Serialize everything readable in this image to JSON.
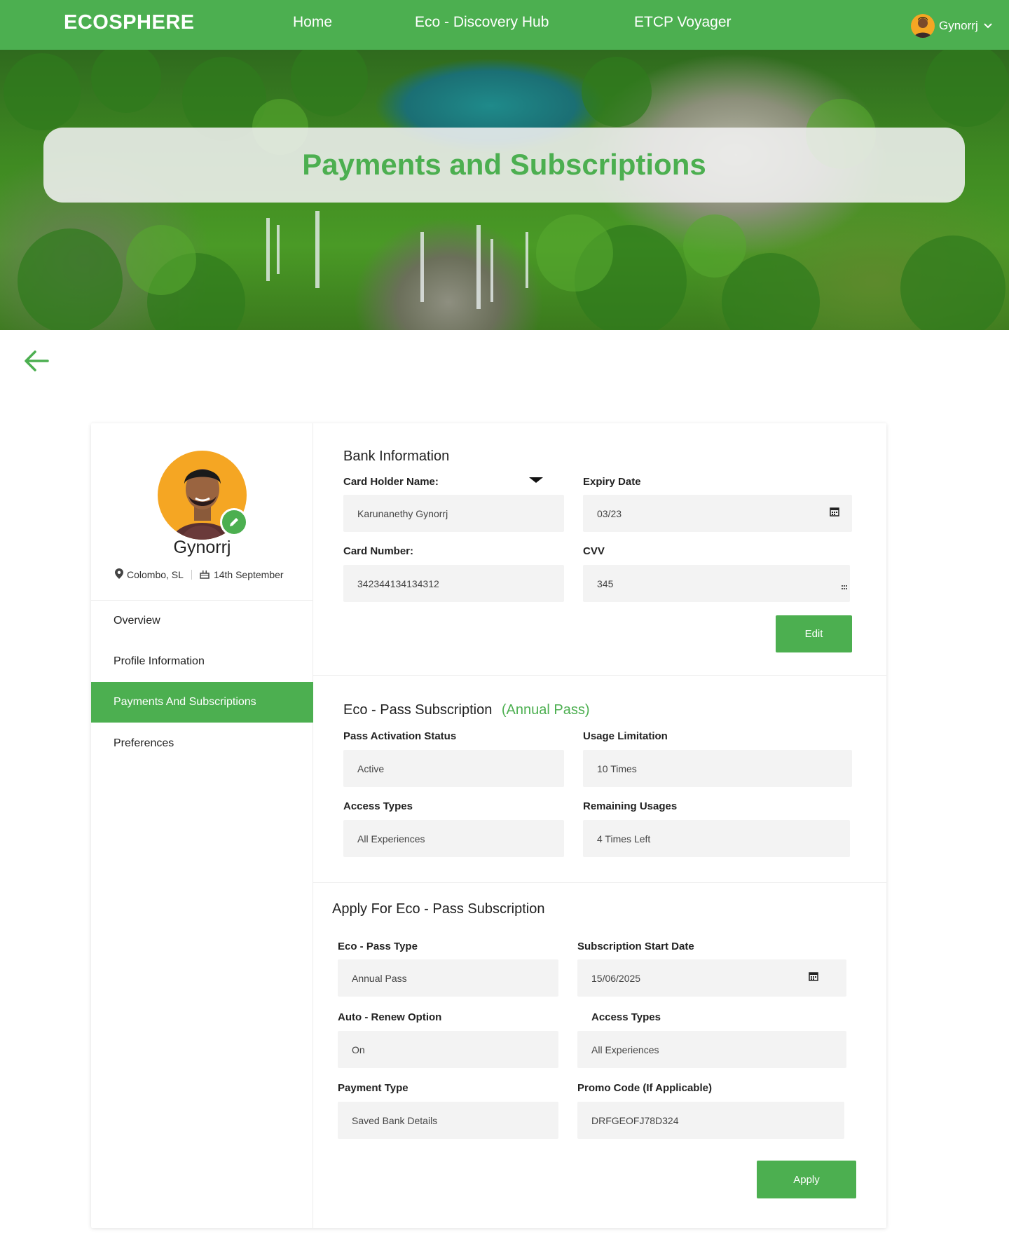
{
  "nav": {
    "brand": "ECOSPHERE",
    "links": [
      "Home",
      "Eco - Discovery Hub",
      "ETCP Voyager"
    ],
    "user_name": "Gynorrj"
  },
  "hero": {
    "title": "Payments and Subscriptions"
  },
  "profile": {
    "name": "Gynorrj",
    "location": "Colombo, SL",
    "birthday": "14th September"
  },
  "sidebar": {
    "items": [
      "Overview",
      "Profile Information",
      "Payments And Subscriptions",
      "Preferences"
    ],
    "active": "Payments And Subscriptions"
  },
  "bank": {
    "title": "Bank Information",
    "card_holder_label": "Card Holder Name:",
    "card_holder_value": "Karunanethy Gynorrj",
    "expiry_label": "Expiry Date",
    "expiry_value": "03/23",
    "card_number_label": "Card Number:",
    "card_number_value": "342344134134312",
    "cvv_label": "CVV",
    "cvv_value": "345",
    "edit_label": "Edit"
  },
  "subscription": {
    "title": "Eco - Pass Subscription",
    "type_badge": "(Annual Pass)",
    "status_label": "Pass Activation Status",
    "status_value": "Active",
    "usage_label": "Usage Limitation",
    "usage_value": "10 Times",
    "access_label": "Access Types",
    "access_value": "All Experiences",
    "remaining_label": "Remaining Usages",
    "remaining_value": "4 Times Left"
  },
  "apply": {
    "title": "Apply For Eco - Pass Subscription",
    "pass_type_label": "Eco - Pass Type",
    "pass_type_value": "Annual Pass",
    "start_date_label": "Subscription Start Date",
    "start_date_value": "15/06/2025",
    "auto_renew_label": "Auto - Renew Option",
    "auto_renew_value": "On",
    "access_label": "Access Types",
    "access_value": "All Experiences",
    "payment_label": "Payment Type",
    "payment_value": "Saved Bank Details",
    "promo_label": "Promo Code (If Applicable)",
    "promo_value": "DRFGEOFJ78D324",
    "apply_label": "Apply"
  },
  "colors": {
    "brand_green": "#4caf50",
    "field_bg": "#f3f3f3"
  }
}
